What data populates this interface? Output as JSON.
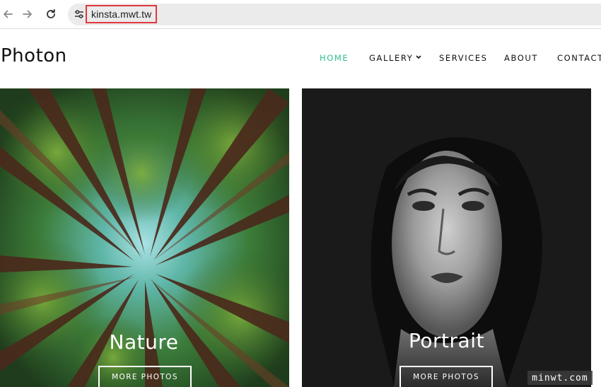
{
  "browser": {
    "url": "kinsta.mwt.tw",
    "icons": {
      "back": "arrow-left-icon",
      "forward": "arrow-right-icon",
      "reload": "reload-icon",
      "site_info": "tune-icon"
    }
  },
  "site": {
    "logo": "Photon",
    "menu": [
      {
        "label": "HOME",
        "active": true
      },
      {
        "label": "GALLERY",
        "has_dropdown": true
      },
      {
        "label": "SERVICES"
      },
      {
        "label": "ABOUT"
      },
      {
        "label": "CONTACT"
      }
    ],
    "accent_color": "#2ebf91"
  },
  "gallery": [
    {
      "title": "Nature",
      "button": "MORE PHOTOS"
    },
    {
      "title": "Portrait",
      "button": "MORE PHOTOS"
    }
  ],
  "watermark": "minwt.com"
}
